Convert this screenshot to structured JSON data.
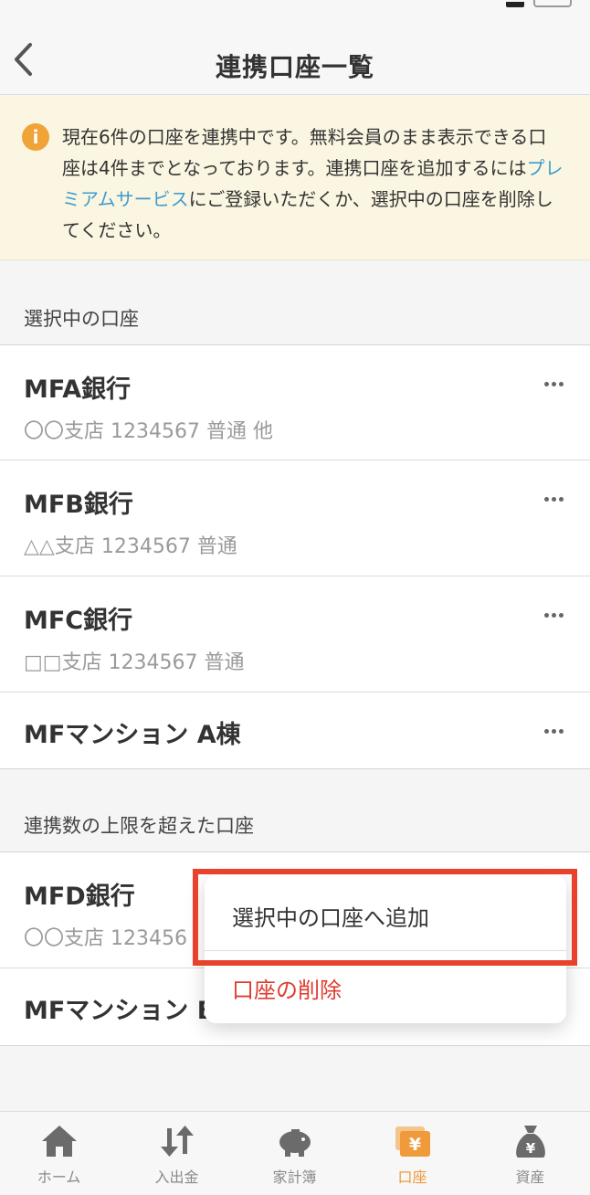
{
  "header": {
    "title": "連携口座一覧"
  },
  "notice": {
    "text_1": "現在6件の口座を連携中です。無料会員のまま表示できる口座は4件までとなっております。連携口座を追加するには",
    "link": "プレミアムサービス",
    "text_2": "にご登録いただくか、選択中の口座を削除してください。"
  },
  "selected_section": {
    "header": "選択中の口座",
    "rows": [
      {
        "title": "MFA銀行",
        "subtitle": "〇〇支店 1234567 普通 他"
      },
      {
        "title": "MFB銀行",
        "subtitle": "△△支店 1234567 普通"
      },
      {
        "title": "MFC銀行",
        "subtitle": "□□支店 1234567 普通"
      },
      {
        "title": "MFマンション A棟"
      }
    ]
  },
  "over_limit_section": {
    "header": "連携数の上限を超えた口座",
    "rows": [
      {
        "title": "MFD銀行",
        "subtitle": "〇〇支店 123456"
      },
      {
        "title": "MFマンション B"
      }
    ]
  },
  "popup": {
    "add_label": "選択中の口座へ追加",
    "delete_label": "口座の削除"
  },
  "tabs": [
    {
      "label": "ホーム"
    },
    {
      "label": "入出金"
    },
    {
      "label": "家計簿"
    },
    {
      "label": "口座"
    },
    {
      "label": "資産"
    }
  ],
  "colors": {
    "accent_orange": "#ef9a3b",
    "link_blue": "#3f9bd0",
    "delete_red": "#e03b2f",
    "highlight_red": "#e8422d",
    "notice_bg": "#fbf6e1"
  },
  "icons": {
    "back": "chevron-left-icon",
    "notice": "info-icon",
    "more": "ellipsis-icon",
    "home": "home-icon",
    "transfer": "arrows-up-down-icon",
    "budget": "piggy-bank-icon",
    "accounts": "wallet-yen-icon",
    "assets": "money-bag-yen-icon"
  }
}
